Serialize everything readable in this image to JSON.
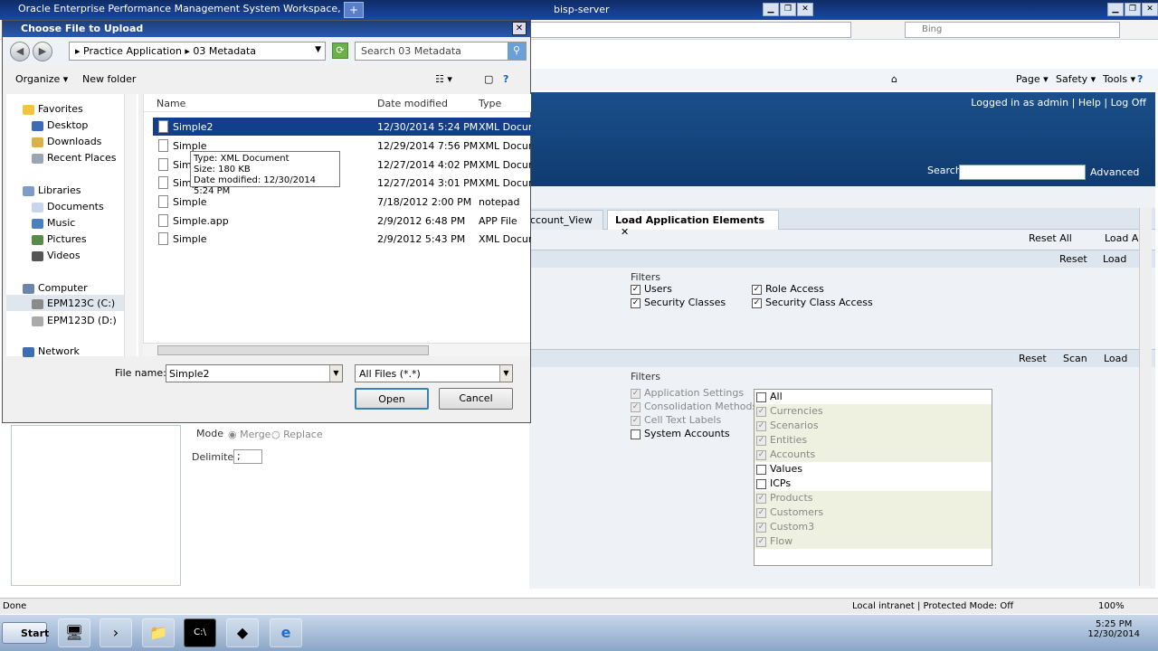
{
  "browser": {
    "title": "Oracle Enterprise Performance Management System Workspace,",
    "new_tab": "+",
    "server": "bisp-server",
    "search_placeholder": "Bing",
    "cmd": {
      "page": "Page ▾",
      "safety": "Safety ▾",
      "tools": "Tools ▾",
      "help": "?"
    },
    "status_done": "Done",
    "zone": "Local intranet | Protected Mode: Off",
    "zoom": "100%"
  },
  "epm": {
    "links": "Logged in as admin  |  Help  |  Log Off",
    "search_label": "Search",
    "advanced": "Advanced",
    "tabs": [
      "ccount_View",
      "Load Application Elements"
    ],
    "reset_all": "Reset All",
    "load_all": "Load All",
    "reset": "Reset",
    "load": "Load",
    "scan": "Scan",
    "filters_label": "Filters",
    "sec_filters": [
      "Users",
      "Security Classes",
      "Role Access",
      "Security Class Access"
    ],
    "meta_filters": [
      "Application Settings",
      "Consolidation Methods",
      "Cell Text Labels",
      "System Accounts"
    ],
    "mode_label": "Mode",
    "merge": "Merge",
    "replace": "Replace",
    "delimiter_label": "Delimiter",
    "delimiter_value": ";",
    "dims": [
      "All",
      "Currencies",
      "Scenarios",
      "Entities",
      "Accounts",
      "Values",
      "ICPs",
      "Products",
      "Customers",
      "Custom3",
      "Flow"
    ]
  },
  "dialog": {
    "title": "Choose File to Upload",
    "close": "✕",
    "back": "◀",
    "forward": "▶",
    "breadcrumb": "▸ Practice Application ▸ 03 Metadata",
    "search_placeholder": "Search 03 Metadata",
    "organize": "Organize ▾",
    "new_folder": "New folder",
    "nav": {
      "favorites": "Favorites",
      "desktop": "Desktop",
      "downloads": "Downloads",
      "recent": "Recent Places",
      "libraries": "Libraries",
      "documents": "Documents",
      "music": "Music",
      "pictures": "Pictures",
      "videos": "Videos",
      "computer": "Computer",
      "drive_c": "EPM123C (C:)",
      "drive_d": "EPM123D (D:)",
      "network": "Network"
    },
    "columns": {
      "name": "Name",
      "date": "Date modified",
      "type": "Type"
    },
    "files": [
      {
        "name": "Simple2",
        "date": "12/30/2014 5:24 PM",
        "type": "XML Docume"
      },
      {
        "name": "Simple",
        "date": "12/29/2014 7:56 PM",
        "type": "XML Docume"
      },
      {
        "name": "Simple",
        "date": "12/27/2014 4:02 PM",
        "type": "XML Docume"
      },
      {
        "name": "Simple",
        "date": "12/27/2014 3:01 PM",
        "type": "XML Docume"
      },
      {
        "name": "Simple",
        "date": "7/18/2012 2:00 PM",
        "type": "notepad"
      },
      {
        "name": "Simple.app",
        "date": "2/9/2012 6:48 PM",
        "type": "APP File"
      },
      {
        "name": "Simple",
        "date": "2/9/2012 5:43 PM",
        "type": "XML Docume"
      }
    ],
    "tooltip": {
      "type": "Type: XML Document",
      "size": "Size: 180 KB",
      "date": "Date modified: 12/30/2014 5:24 PM"
    },
    "filename_label": "File name:",
    "filename_value": "Simple2",
    "filetype_value": "All Files (*.*)",
    "open": "Open",
    "cancel": "Cancel"
  },
  "taskbar": {
    "start": "Start",
    "time": "5:25 PM",
    "date": "12/30/2014"
  }
}
